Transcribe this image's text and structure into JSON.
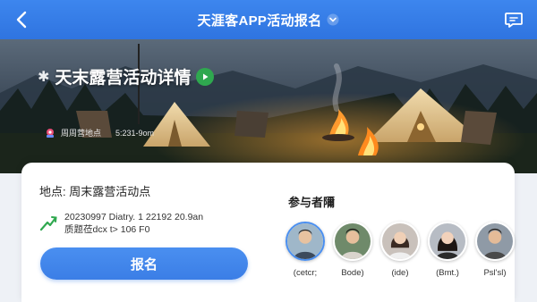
{
  "header": {
    "title": "天涯客APP活动报名",
    "back_icon": "back-arrow-icon",
    "message_icon": "chat-icon",
    "bg_color": "#2f74e0"
  },
  "banner": {
    "title": "天末露营活动详情",
    "location_label": "周周营地点",
    "time_text": "5:231-9om",
    "play_icon": "play-icon",
    "play_color": "#2fa84f"
  },
  "info": {
    "location_line": "地点: 周末露营活动点",
    "date_line1": "20230997  Diatry. 1 22192 20.9an",
    "date_line2": "质题莅dcx t> 106 F0",
    "signup_label": "报名",
    "accent": "#3b7ee6"
  },
  "participants": {
    "title": "参与者隬",
    "people": [
      {
        "name": "(cetcr;"
      },
      {
        "name": "Bode)"
      },
      {
        "name": "(ide)"
      },
      {
        "name": "(Bmt.)"
      },
      {
        "name": "Psl'sl)"
      }
    ]
  }
}
